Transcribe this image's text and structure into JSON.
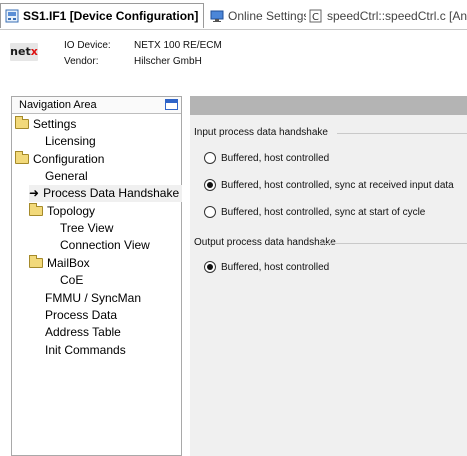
{
  "tabs": [
    {
      "label": "SS1.IF1 [Device Configuration]",
      "icon": "device-config-icon",
      "active": true,
      "closable": true
    },
    {
      "label": "Online Settings",
      "icon": "monitor-icon",
      "active": false
    },
    {
      "label": "speedCtrl::speedCtrl.c [Ansi C]",
      "icon": "c-file-icon",
      "active": false
    }
  ],
  "device": {
    "logo": "netx",
    "io_device_label": "IO Device:",
    "io_device_value": "NETX 100 RE/ECM",
    "vendor_label": "Vendor:",
    "vendor_value": "Hilscher GmbH"
  },
  "navigation": {
    "title": "Navigation Area",
    "items": [
      {
        "label": "Settings",
        "type": "folder"
      },
      {
        "label": "Licensing",
        "type": "leaf"
      },
      {
        "label": "Configuration",
        "type": "folder"
      },
      {
        "label": "General",
        "type": "leaf"
      },
      {
        "label": "Process Data Handshake",
        "type": "leaf",
        "selected": true
      },
      {
        "label": "Topology",
        "type": "folder"
      },
      {
        "label": "Tree View",
        "type": "leaf"
      },
      {
        "label": "Connection View",
        "type": "leaf"
      },
      {
        "label": "MailBox",
        "type": "folder"
      },
      {
        "label": "CoE",
        "type": "leaf"
      },
      {
        "label": "FMMU / SyncMan",
        "type": "leaf"
      },
      {
        "label": "Process Data",
        "type": "leaf"
      },
      {
        "label": "Address Table",
        "type": "leaf"
      },
      {
        "label": "Init Commands",
        "type": "leaf"
      }
    ]
  },
  "input_handshake": {
    "title": "Input process data handshake",
    "options": [
      {
        "label": "Buffered, host controlled",
        "checked": false
      },
      {
        "label": "Buffered, host controlled, sync at received input data",
        "checked": true
      },
      {
        "label": "Buffered, host controlled, sync at start of cycle",
        "checked": false
      }
    ]
  },
  "output_handshake": {
    "title": "Output process data handshake",
    "options": [
      {
        "label": "Buffered, host controlled",
        "checked": true
      }
    ]
  },
  "colors": {
    "panel_bar": "#b4b4b4",
    "panel_bg": "#f0f0f0",
    "selection_arrow": "#000000"
  }
}
